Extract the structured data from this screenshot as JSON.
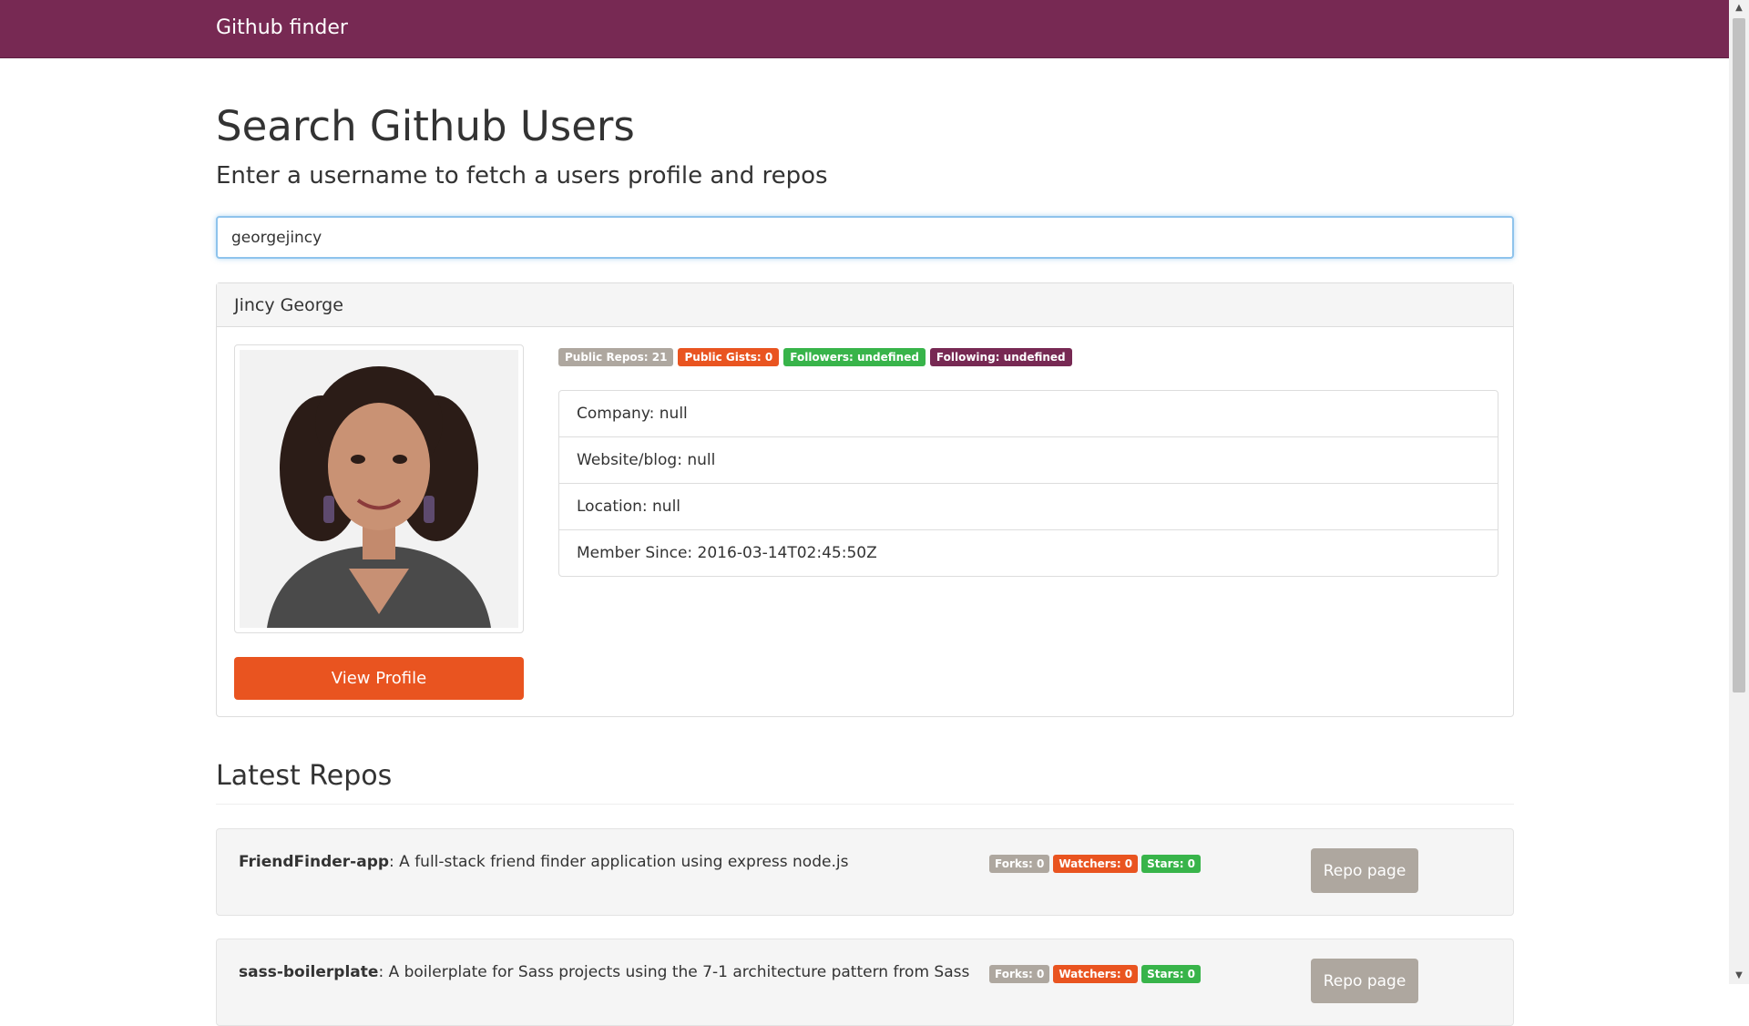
{
  "navbar": {
    "brand": "Github finder"
  },
  "header": {
    "title": "Search Github Users",
    "subtitle": "Enter a username to fetch a users profile and repos"
  },
  "search": {
    "value": "georgejincy"
  },
  "profile": {
    "name": "Jincy George",
    "badges": {
      "public_repos": "Public Repos: 21",
      "public_gists": "Public Gists: 0",
      "followers": "Followers: undefined",
      "following": "Following: undefined"
    },
    "details": {
      "company": "Company: null",
      "website": "Website/blog: null",
      "location": "Location: null",
      "member_since": "Member Since: 2016-03-14T02:45:50Z"
    },
    "view_profile_label": "View Profile"
  },
  "repos": {
    "title": "Latest Repos",
    "items": [
      {
        "name": "FriendFinder-app",
        "description": ": A full-stack friend finder application using express node.js",
        "forks": "Forks: 0",
        "watchers": "Watchers: 0",
        "stars": "Stars: 0",
        "button": "Repo page"
      },
      {
        "name": "sass-boilerplate",
        "description": ": A boilerplate for Sass projects using the 7-1 architecture pattern from Sass",
        "forks": "Forks: 0",
        "watchers": "Watchers: 0",
        "stars": "Stars: 0",
        "button": "Repo page"
      }
    ]
  },
  "colors": {
    "navbar": "#772953",
    "primary": "#e95420",
    "success": "#38b44a",
    "default": "#aea79f"
  }
}
